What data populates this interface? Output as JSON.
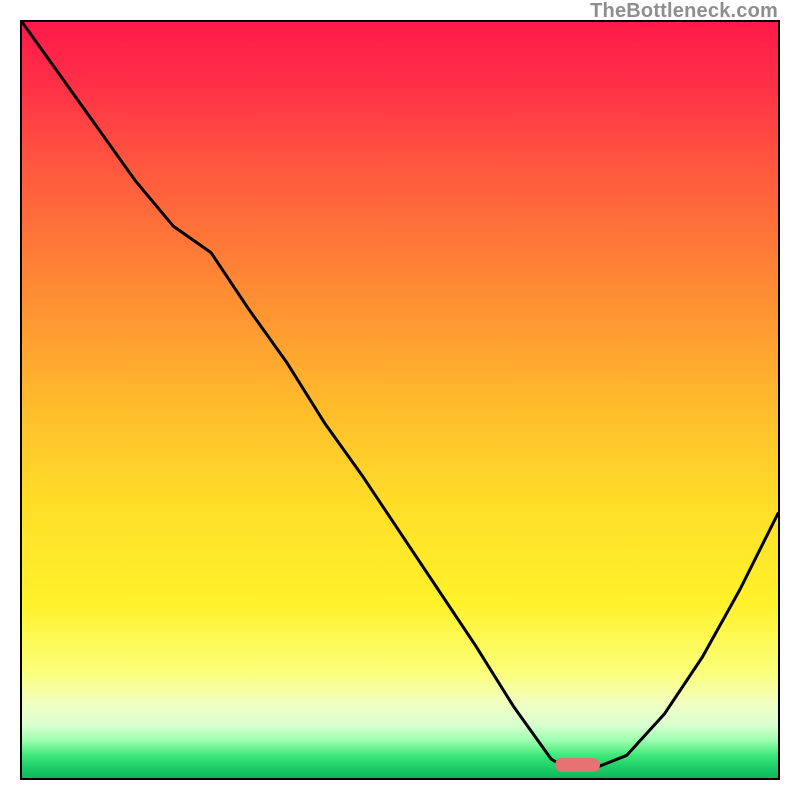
{
  "watermark": "TheBottleneck.com",
  "chart_data": {
    "type": "line",
    "title": "",
    "xlabel": "",
    "ylabel": "",
    "x": [
      0.0,
      0.05,
      0.1,
      0.15,
      0.2,
      0.25,
      0.3,
      0.35,
      0.4,
      0.45,
      0.5,
      0.55,
      0.6,
      0.65,
      0.7,
      0.725,
      0.75,
      0.8,
      0.85,
      0.9,
      0.95,
      1.0
    ],
    "values": [
      1.0,
      0.93,
      0.86,
      0.79,
      0.73,
      0.695,
      0.62,
      0.55,
      0.47,
      0.4,
      0.325,
      0.25,
      0.175,
      0.095,
      0.025,
      0.01,
      0.01,
      0.03,
      0.085,
      0.16,
      0.25,
      0.35
    ],
    "xlim": [
      0,
      1
    ],
    "ylim": [
      0,
      1
    ],
    "background": "red-yellow-green vertical gradient",
    "optimal_marker_x": 0.735,
    "optimal_marker_width": 0.06
  },
  "colors": {
    "curve": "#000000",
    "marker": "#e57373",
    "frame": "#000000"
  }
}
